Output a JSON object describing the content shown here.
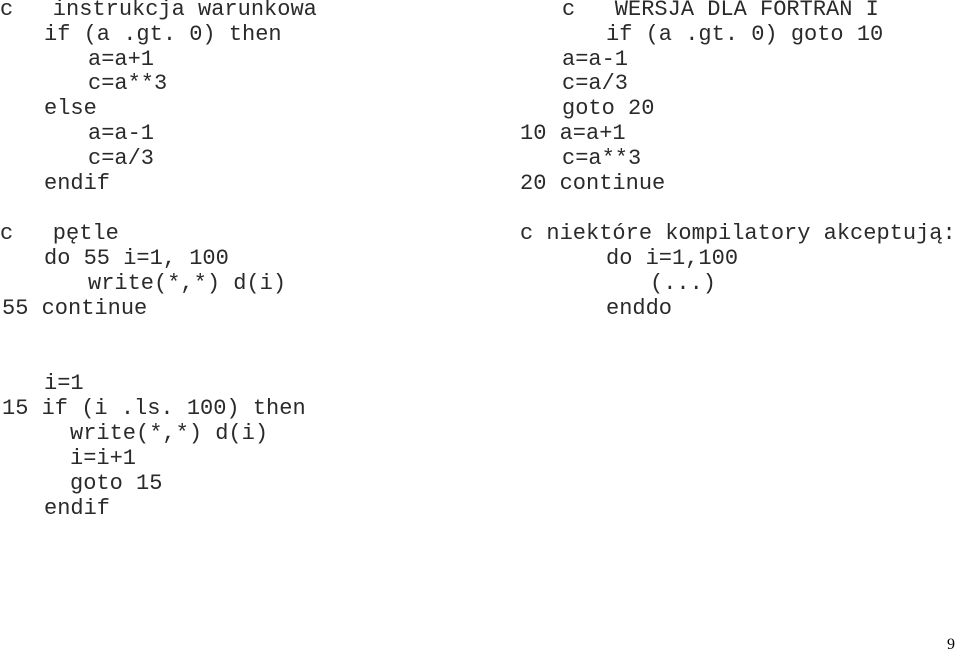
{
  "left_top": [
    "c   instrukcja warunkowa",
    "if (a .gt. 0) then",
    "a=a+1",
    "c=a**3",
    "else",
    "a=a-1",
    "c=a/3",
    "endif"
  ],
  "left_loop": [
    "c   pętle",
    "do 55 i=1, 100",
    "write(*,*) d(i)",
    "55 continue"
  ],
  "left_bottom": [
    "i=1",
    "15 if (i .ls. 100) then",
    "write(*,*) d(i)",
    "i=i+1",
    "goto 15",
    "endif"
  ],
  "right_top": [
    "c   WERSJA DLA FORTRAN I",
    "if (a .gt. 0) goto 10",
    "a=a-1",
    "c=a/3",
    "goto 20",
    "10 a=a+1",
    "c=a**3",
    "20 continue"
  ],
  "right_loop": [
    "c niektóre kompilatory akceptują:",
    "do i=1,100",
    "(...)",
    "enddo"
  ],
  "page_number": "9"
}
